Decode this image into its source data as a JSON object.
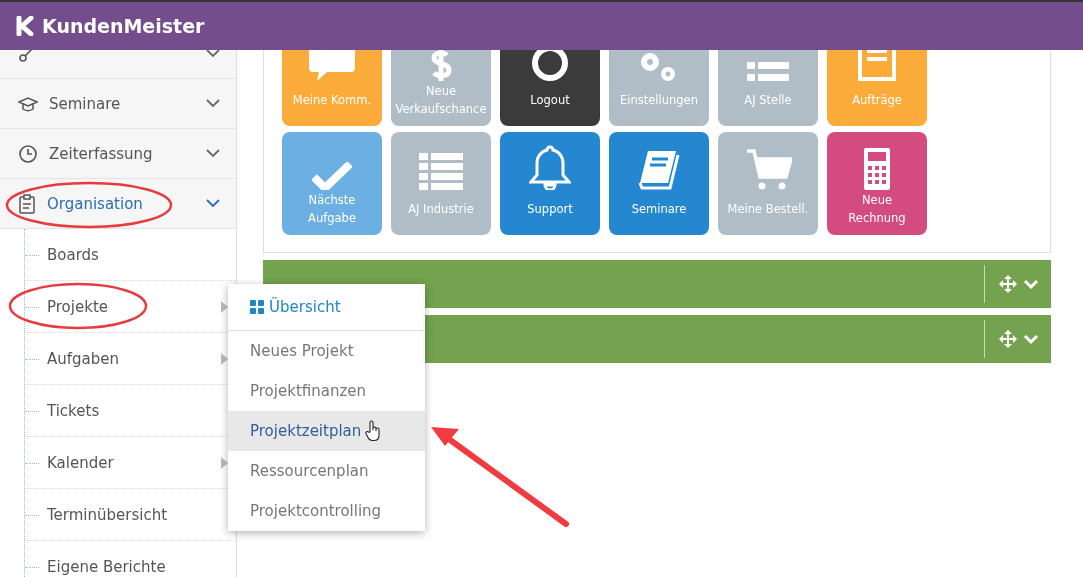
{
  "header": {
    "logo_text": "KundenMeister"
  },
  "sidebar": {
    "items": [
      {
        "selected": false
      },
      {
        "label": "Seminare",
        "selected": false
      },
      {
        "label": "Zeiterfassung",
        "selected": false
      },
      {
        "label": "Organisation",
        "selected": true,
        "children": [
          {
            "label": "Boards",
            "has_submenu": false
          },
          {
            "label": "Projekte",
            "has_submenu": true
          },
          {
            "label": "Aufgaben",
            "has_submenu": true
          },
          {
            "label": "Tickets",
            "has_submenu": false
          },
          {
            "label": "Kalender",
            "has_submenu": true
          },
          {
            "label": "Terminübersicht",
            "has_submenu": false
          },
          {
            "label": "Eigene Berichte",
            "has_submenu": false
          }
        ]
      }
    ]
  },
  "tiles": [
    {
      "label": "Meine Komm.",
      "color": "#fbab3a"
    },
    {
      "label": "Neue\nVerkaufschance",
      "color": "#b0bdc7"
    },
    {
      "label": "Logout",
      "color": "#3b3b3b"
    },
    {
      "label": "Einstellungen",
      "color": "#b0bdc7"
    },
    {
      "label": "AJ Stelle",
      "color": "#b0bdc7"
    },
    {
      "label": "Aufträge",
      "color": "#fbab3a"
    },
    {
      "label": "Nächste\nAufgabe",
      "color": "#6cafe2"
    },
    {
      "label": "AJ Industrie",
      "color": "#b0bdc7"
    },
    {
      "label": "Support",
      "color": "#2487cf"
    },
    {
      "label": "Seminare",
      "color": "#2487cf"
    },
    {
      "label": "Meine Bestell.",
      "color": "#b0bdc7"
    },
    {
      "label": "Neue\nRechnung",
      "color": "#d44b7f"
    }
  ],
  "dropdown": {
    "header": "Übersicht",
    "items": [
      {
        "label": "Neues Projekt",
        "hovered": false
      },
      {
        "label": "Projektfinanzen",
        "hovered": false
      },
      {
        "label": "Projektzeitplan",
        "hovered": true
      },
      {
        "label": "Ressourcenplan",
        "hovered": false
      },
      {
        "label": "Projektcontrolling",
        "hovered": false
      }
    ]
  }
}
